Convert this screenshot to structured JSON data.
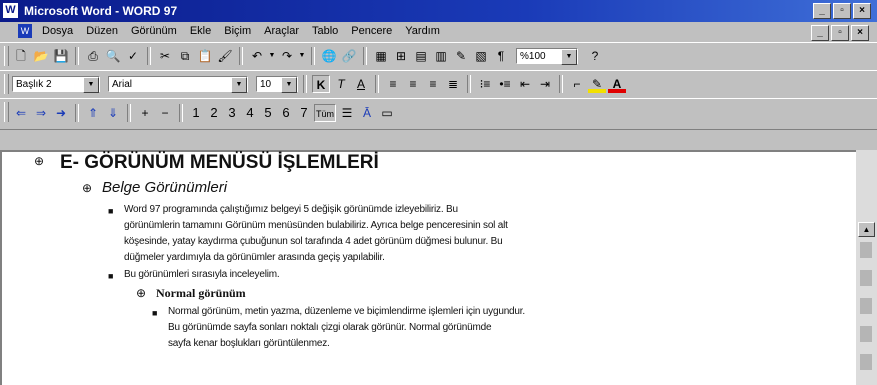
{
  "window": {
    "title": "Microsoft Word - WORD 97",
    "app_icon": "W"
  },
  "menubar": {
    "items": [
      "Dosya",
      "Düzen",
      "Görünüm",
      "Ekle",
      "Biçim",
      "Araçlar",
      "Tablo",
      "Pencere",
      "Yardım"
    ],
    "icon": "word-doc-icon"
  },
  "toolbar_format": {
    "style": "Başlık 2",
    "font": "Arial",
    "size": "10",
    "zoom": "%100"
  },
  "toolbar_numbers": {
    "items": [
      "1",
      "2",
      "3",
      "4",
      "5",
      "6",
      "7"
    ],
    "level": "Tüm"
  },
  "document": {
    "heading1": "E- GÖRÜNÜM MENÜSÜ İŞLEMLERİ",
    "heading2": "Belge Görünümleri",
    "para1": [
      "Word 97 programında çalıştığımız belgeyi 5 değişik görünümde izleyebiliriz. Bu",
      "görünümlerin tamamını Görünüm menüsünden bulabiliriz. Ayrıca belge penceresinin sol alt",
      "köşesinde, yatay kaydırma çubuğunun sol tarafında 4 adet görünüm düğmesi bulunur. Bu",
      "düğmeler yardımıyla da görünümler arasında geçiş yapılabilir."
    ],
    "para2": "Bu görünümleri sırasıyla inceleyelim.",
    "heading3": "Normal görünüm",
    "para3": [
      "Normal görünüm, metin yazma, düzenleme ve biçimlendirme işlemleri için uygundur.",
      "Bu görünümde sayfa sonları noktalı çizgi olarak görünür. Normal görünümde",
      "sayfa kenar boşlukları görüntülenmez."
    ]
  },
  "colors": {
    "titlebar": "#0a1a8a",
    "highlight": "#f2e000",
    "fontcolor": "#e00000"
  }
}
